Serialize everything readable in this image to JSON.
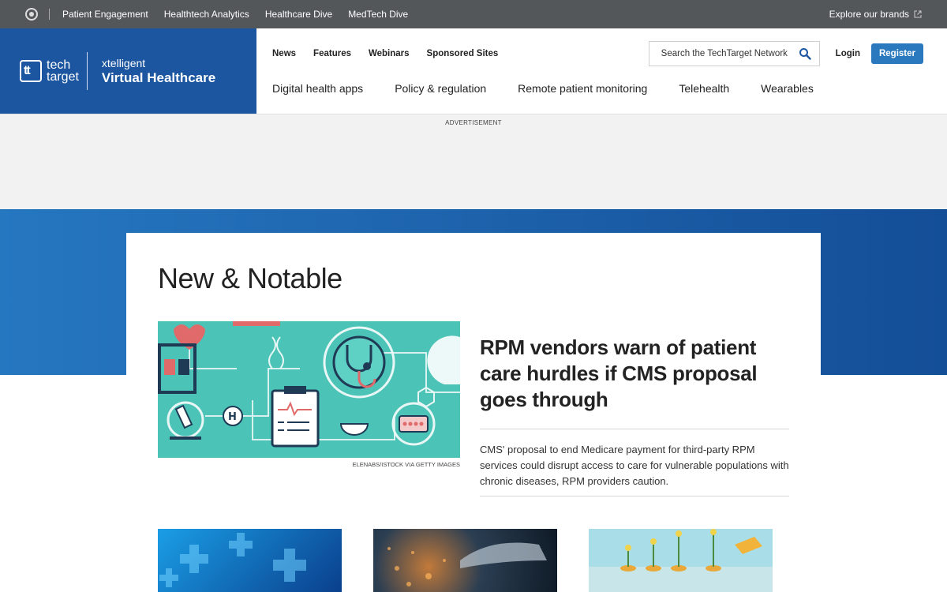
{
  "topbar": {
    "links": [
      "Patient Engagement",
      "Healthtech Analytics",
      "Healthcare Dive",
      "MedTech Dive"
    ],
    "explore": "Explore our brands"
  },
  "brand": {
    "tt_line1": "tech",
    "tt_line2": "target",
    "pub_small": "xtelligent",
    "pub_big": "Virtual Healthcare"
  },
  "nav": {
    "primary": [
      "News",
      "Features",
      "Webinars",
      "Sponsored Sites"
    ],
    "search_placeholder": "Search the TechTarget Network",
    "login": "Login",
    "register": "Register",
    "topics": [
      "Digital health apps",
      "Policy & regulation",
      "Remote patient monitoring",
      "Telehealth",
      "Wearables"
    ]
  },
  "ad": {
    "label": "ADVERTISEMENT"
  },
  "section": {
    "title": "New & Notable"
  },
  "feature": {
    "credit": "ELENABS/ISTOCK VIA GETTY IMAGES",
    "headline": "RPM vendors warn of patient care hurdles if CMS proposal goes through",
    "summary": "CMS' proposal to end Medicare payment for third-party RPM services could disrupt access to care for vulnerable populations with chronic diseases, RPM providers caution."
  },
  "colors": {
    "brand_blue": "#1d56a0",
    "register_blue": "#2a78bd",
    "topbar": "#53575a",
    "illustration_teal": "#4cc3b7"
  }
}
